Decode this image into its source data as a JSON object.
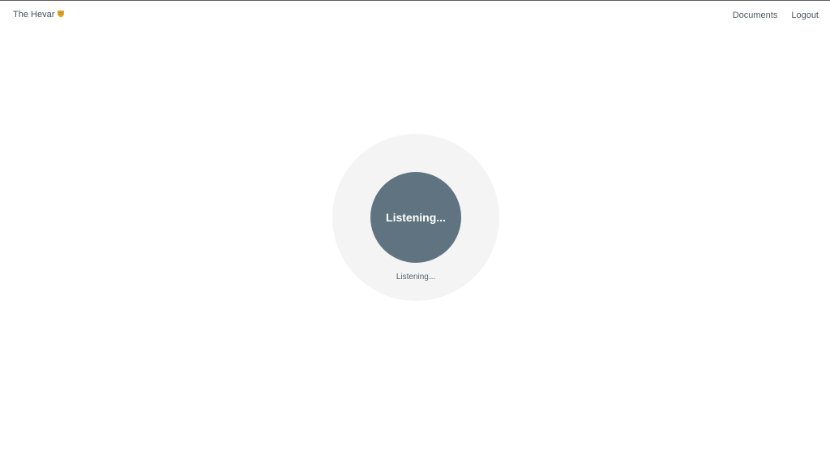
{
  "navbar": {
    "brand_label": "The Hevar",
    "brand_icon": "shield-emoji-icon",
    "links": [
      {
        "label": "Documents"
      },
      {
        "label": "Logout"
      }
    ]
  },
  "voice": {
    "button_label": "Listening...",
    "status_text": "Listening..."
  },
  "colors": {
    "outer_circle": "#f4f4f4",
    "inner_circle": "#5f7480",
    "brand_icon": "#e0a82e"
  }
}
